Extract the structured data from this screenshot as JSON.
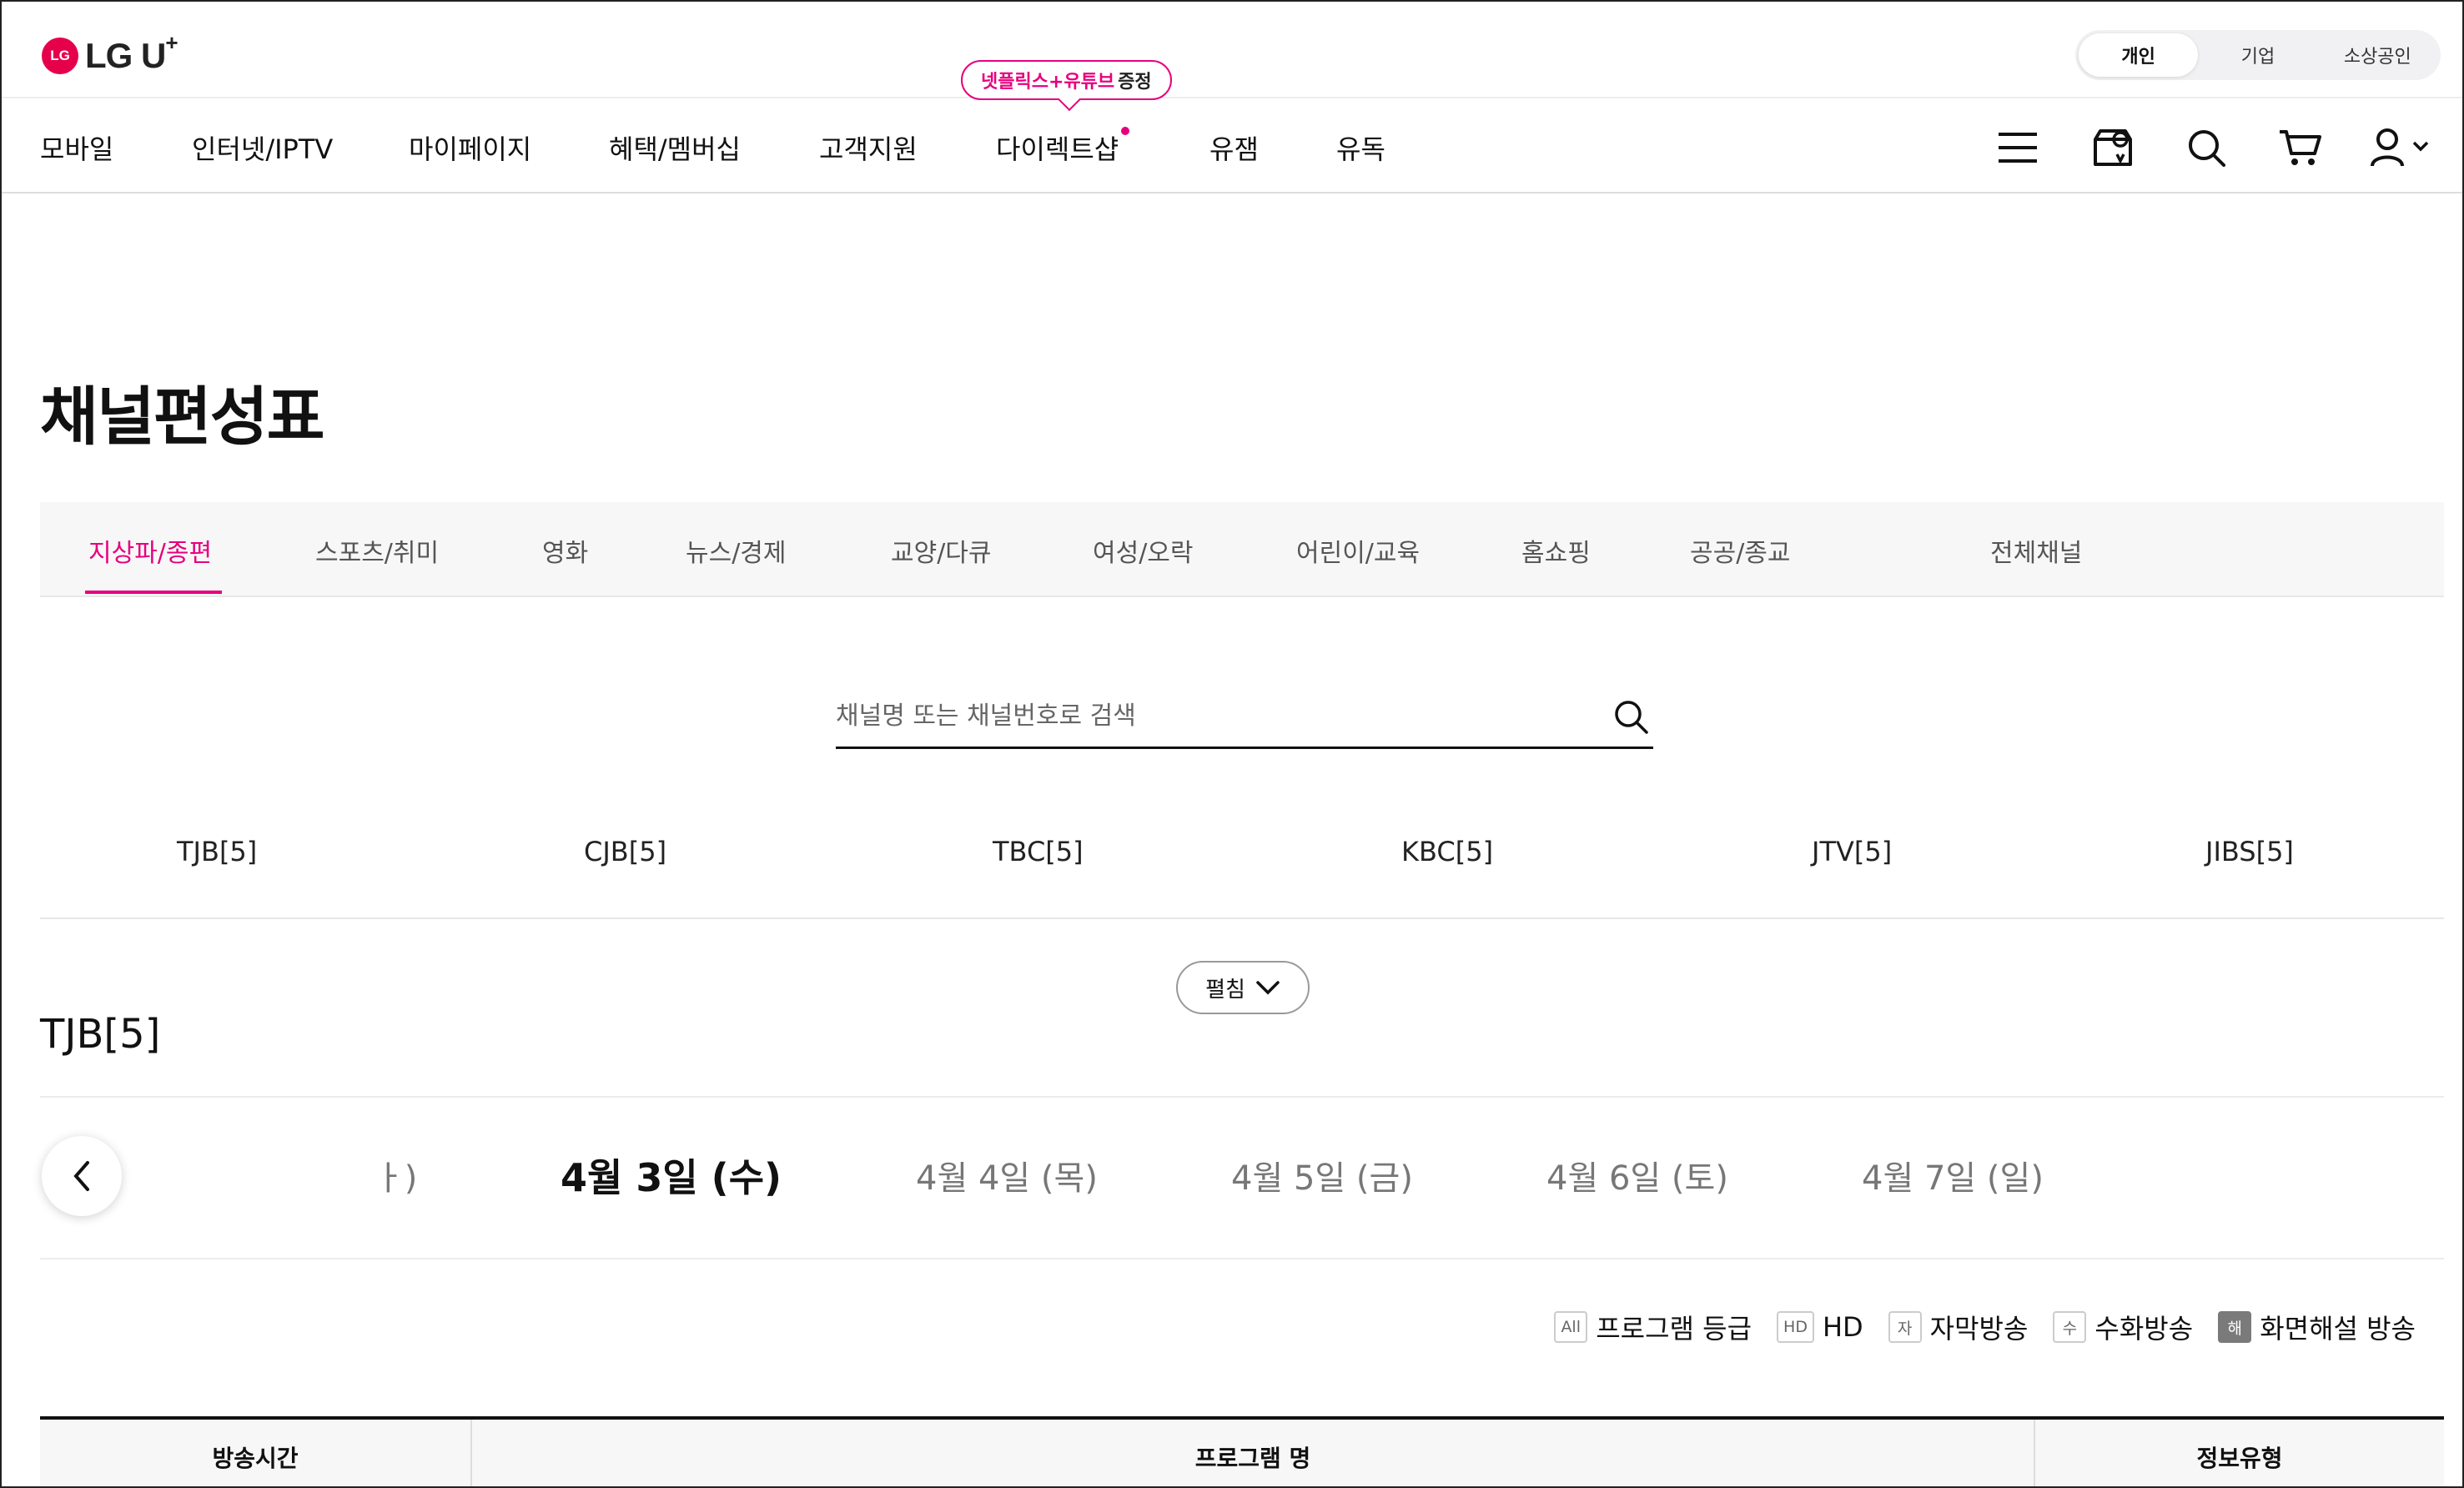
{
  "brand": {
    "logo_mark": "LG",
    "logo_text": "LG U",
    "logo_plus": "+"
  },
  "audience_tabs": [
    "개인",
    "기업",
    "소상공인"
  ],
  "promo": {
    "highlight": "넷플릭스+유튜브",
    "text": "증정"
  },
  "nav": {
    "items": [
      "모바일",
      "인터넷/IPTV",
      "마이페이지",
      "혜택/멤버십",
      "고객지원",
      "다이렉트샵",
      "유잼",
      "유독"
    ],
    "icons": [
      "menu-icon",
      "store-location-icon",
      "search-icon",
      "cart-icon",
      "user-icon"
    ]
  },
  "page_title": "채널편성표",
  "categories": [
    "지상파/종편",
    "스포츠/취미",
    "영화",
    "뉴스/경제",
    "교양/다큐",
    "여성/오락",
    "어린이/교육",
    "홈쇼핑",
    "공공/종교",
    "전체채널"
  ],
  "search": {
    "placeholder": "채널명 또는 채널번호로 검색",
    "value": ""
  },
  "channels": [
    "TJB[5]",
    "CJB[5]",
    "TBC[5]",
    "KBC[5]",
    "JTV[5]",
    "JIBS[5]"
  ],
  "expand_label": "펼침",
  "channel_title": "TJB[5]",
  "dates": {
    "partial": "ㅏ)",
    "items": [
      "4월 3일 (수)",
      "4월 4일 (목)",
      "4월 5일 (금)",
      "4월 6일 (토)",
      "4월 7일 (일)"
    ]
  },
  "legend": [
    {
      "badge": "All",
      "label": "프로그램 등급"
    },
    {
      "badge": "HD",
      "label": "HD"
    },
    {
      "badge": "자",
      "label": "자막방송"
    },
    {
      "badge": "수",
      "label": "수화방송"
    },
    {
      "badge": "해",
      "label": "화면해설 방송"
    }
  ],
  "table_headers": [
    "방송시간",
    "프로그램 명",
    "정보유형"
  ],
  "colors": {
    "accent": "#e6007e",
    "text": "#111111"
  }
}
